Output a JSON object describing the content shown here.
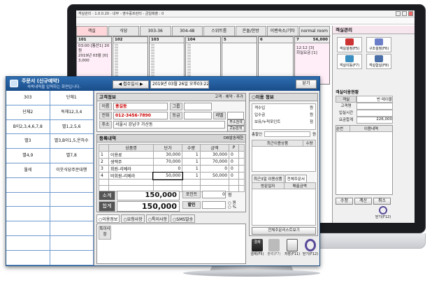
{
  "back": {
    "title": "객실관리 - 1.0.0.20 - 내부 - 영수증프린터 - 금일매출 : 0",
    "tabs": [
      "객실",
      "식당",
      "303-36",
      "304-48",
      "스위트룸",
      "온돌/한방",
      "이벤숙소/기타",
      "normal room"
    ],
    "rooms": [
      {
        "no": "101",
        "lines": [
          "",
          "03:00 [통산1] 20 원",
          "2019년 03월 [0]",
          "3,000"
        ]
      },
      {
        "no": "102",
        "lines": []
      },
      {
        "no": "103",
        "lines": []
      },
      {
        "no": "104",
        "lines": []
      },
      {
        "no": "5",
        "lines": []
      },
      {
        "no": "6",
        "lines": []
      },
      {
        "no": "7",
        "lines": [
          "56,000",
          "12:12 [3]",
          "회실요금 [1]"
        ]
      }
    ],
    "panel": {
      "title": "객실관리",
      "buttons": [
        "객실설정(F5)",
        "구조설정(F6)",
        "객실이동(F7)",
        "객실합실(F8)"
      ],
      "status_title": "객실이용현황",
      "status_rows": [
        [
          "객실",
          "번 테이블"
        ],
        [
          "고객명",
          ""
        ],
        [
          "입실시간",
          ""
        ],
        [
          "요금합계",
          "226,000"
        ]
      ],
      "list_headers": [
        "순번",
        "이용내역"
      ],
      "bottom_buttons": [
        "수정",
        "계산",
        "취소"
      ],
      "close": "닫기(F12)"
    }
  },
  "front": {
    "title": "주문서 (신규예약)",
    "subtitle": "숙박내역을 입력하는 화면입니다.",
    "nav": "◀ 접수일시 ▶",
    "date": "2019년 03월 26일 오후03:22",
    "close_btn": "닫기",
    "left_grid": [
      "303",
      "단체1",
      "단체2",
      "독채12,3,4",
      "B이2,3,4,6,7,8",
      "별1,2,5,6",
      "별3",
      "별3,B이1,5,온하수",
      "별4,9",
      "별7,8",
      "월세",
      "이웃식당주문대행"
    ],
    "customer": {
      "section": "고객정보",
      "opts": [
        "고객",
        "예약",
        "추가"
      ],
      "name_label": "이름",
      "name": "홍길동",
      "group_label": "그룹",
      "phone_label": "전화",
      "phone": "012-3456-7890",
      "grade_label": "등급",
      "level_label": "레벨",
      "addr_label": "주소",
      "addr": "서울시 강남구 가산동",
      "addr_btn": "주소검색",
      "zip_btn": "Zip검색"
    },
    "order": {
      "section": "등록내역",
      "bar_btn": "DB발송제한",
      "headers": [
        "",
        "상품명",
        "단가",
        "수량",
        "금액",
        "P",
        ""
      ],
      "rows": [
        [
          "1",
          "이용료",
          "30,000",
          "1",
          "30,000",
          "0"
        ],
        [
          "2",
          "생맥주",
          "70,000",
          "1",
          "70,000",
          "0"
        ],
        [
          "3",
          "회원-리베라",
          "0",
          "1",
          "0",
          "0"
        ],
        [
          "4",
          "비회원-리베라",
          "50,000",
          "1",
          "50,000",
          "0"
        ]
      ],
      "subtotal_label": "소계",
      "subtotal": "150,000",
      "total_label": "합계",
      "total": "150,000",
      "point_label": "포인트",
      "point": "0",
      "point_unit": "점",
      "discount_label": "할인",
      "radio": [
        "원",
        "%"
      ]
    },
    "bottom_tabs": [
      "이용정보",
      "요청사항",
      "특이사항",
      "SMS발송"
    ],
    "memo_label": "특이사항",
    "usage": {
      "section": "이용 정보",
      "rows": [
        [
          "객수입",
          "원"
        ],
        [
          "입수금",
          "원"
        ],
        [
          "보유/누적포인트",
          "점"
        ]
      ],
      "balance_label": "총할인",
      "balance_unit": "원",
      "list_headers": [
        "최근이용상품",
        "수량"
      ],
      "tabs": [
        "최근3일 이용상품",
        "전체주문서"
      ],
      "list2_headers": [
        "방문일자",
        "매출금액"
      ],
      "view_btn": "전체주문리스트보기"
    },
    "actions": [
      "결제(F5)",
      "출력(F7)",
      "저장(F11)",
      "닫기(F12)"
    ]
  }
}
